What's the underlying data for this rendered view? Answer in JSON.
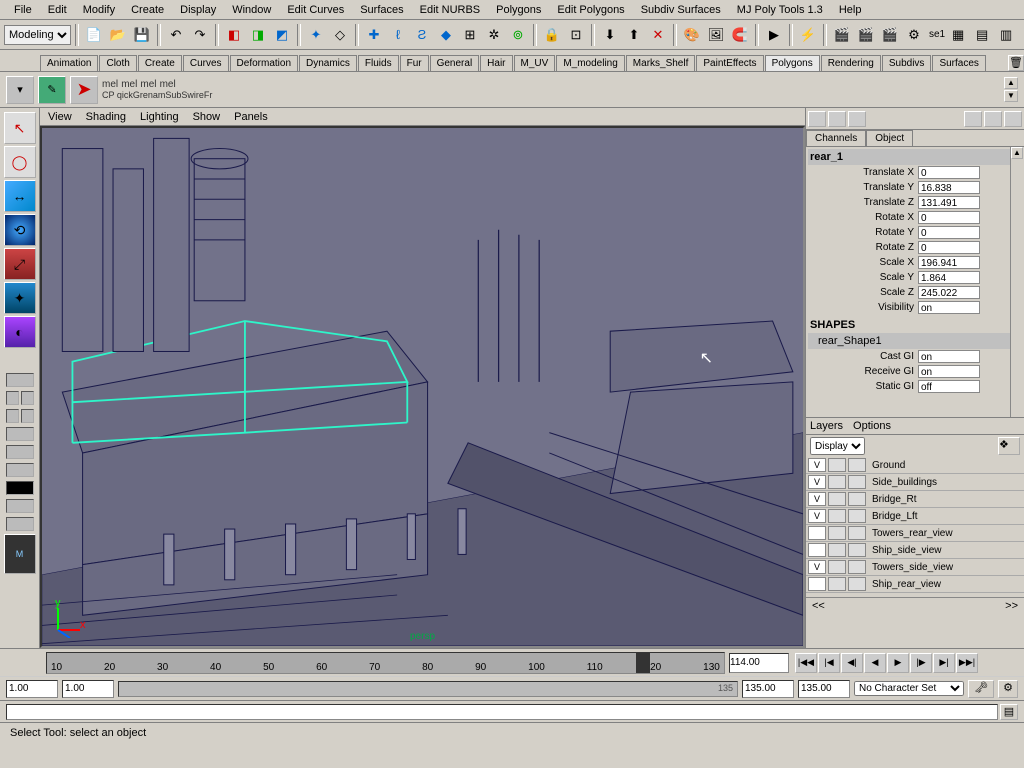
{
  "menu": [
    "File",
    "Edit",
    "Modify",
    "Create",
    "Display",
    "Window",
    "Edit Curves",
    "Surfaces",
    "Edit NURBS",
    "Polygons",
    "Edit Polygons",
    "Subdiv Surfaces",
    "MJ Poly Tools 1.3",
    "Help"
  ],
  "mode_selector": "Modeling",
  "toolbar_text": "se1",
  "shelf_tabs": [
    "Animation",
    "Cloth",
    "Create",
    "Curves",
    "Deformation",
    "Dynamics",
    "Fluids",
    "Fur",
    "General",
    "Hair",
    "M_UV",
    "M_modeling",
    "Marks_Shelf",
    "PaintEffects",
    "Polygons",
    "Rendering",
    "Subdivs",
    "Surfaces"
  ],
  "shelf_active": "Polygons",
  "shelf_mel_labels": [
    "mel",
    "mel",
    "mel",
    "mel"
  ],
  "shelf_sub": "CP  qickGrenamSubSwireFr",
  "viewport_menu": [
    "View",
    "Shading",
    "Lighting",
    "Show",
    "Panels"
  ],
  "viewport_label": "persp",
  "channel_tabs": [
    "Channels",
    "Object"
  ],
  "channel_object": "rear_1",
  "channel_attrs": [
    {
      "lbl": "Translate X",
      "val": "0"
    },
    {
      "lbl": "Translate Y",
      "val": "16.838"
    },
    {
      "lbl": "Translate Z",
      "val": "131.491"
    },
    {
      "lbl": "Rotate X",
      "val": "0"
    },
    {
      "lbl": "Rotate Y",
      "val": "0"
    },
    {
      "lbl": "Rotate Z",
      "val": "0"
    },
    {
      "lbl": "Scale X",
      "val": "196.941"
    },
    {
      "lbl": "Scale Y",
      "val": "1.864"
    },
    {
      "lbl": "Scale Z",
      "val": "245.022"
    },
    {
      "lbl": "Visibility",
      "val": "on"
    }
  ],
  "shapes_header": "SHAPES",
  "shape_name": "rear_Shape1",
  "shape_attrs": [
    {
      "lbl": "Cast GI",
      "val": "on"
    },
    {
      "lbl": "Receive GI",
      "val": "on"
    },
    {
      "lbl": "Static GI",
      "val": "off"
    }
  ],
  "layers_tabs": [
    "Layers",
    "Options"
  ],
  "layers_mode": "Display",
  "layers": [
    {
      "vis": "V",
      "name": "Ground"
    },
    {
      "vis": "V",
      "name": "Side_buildings"
    },
    {
      "vis": "V",
      "name": "Bridge_Rt"
    },
    {
      "vis": "V",
      "name": "Bridge_Lft"
    },
    {
      "vis": "",
      "name": "Towers_rear_view"
    },
    {
      "vis": "",
      "name": "Ship_side_view"
    },
    {
      "vis": "V",
      "name": "Towers_side_view"
    },
    {
      "vis": "",
      "name": "Ship_rear_view"
    }
  ],
  "time_ticks": [
    "10",
    "20",
    "30",
    "40",
    "50",
    "60",
    "70",
    "80",
    "90",
    "100",
    "110",
    "120",
    "130"
  ],
  "current_time": "114.00",
  "range_start": "1.00",
  "range_start2": "1.00",
  "range_end": "135.00",
  "range_end2": "135.00",
  "range_display": "135",
  "character_set": "No Character Set",
  "help_text": "Select Tool: select an object",
  "scroll_labels": {
    "left": "<<",
    "right": ">>"
  }
}
